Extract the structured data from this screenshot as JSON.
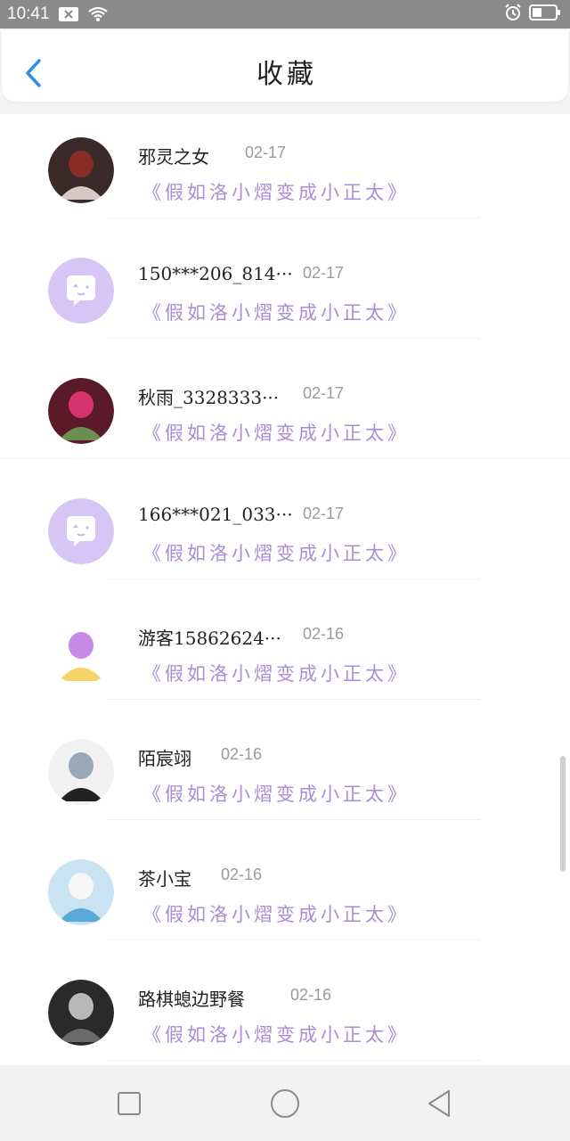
{
  "status_bar": {
    "time": "10:41"
  },
  "header": {
    "title": "收藏",
    "back_icon": "chevron-left-icon",
    "accent_color": "#2f8ee8"
  },
  "list": [
    {
      "name": "邪灵之女",
      "date": "02-17",
      "message": "《假如洛小熠变成小正太》",
      "avatar": "photo"
    },
    {
      "name": "150***206_814···",
      "date": "02-17",
      "message": "《假如洛小熠变成小正太》",
      "avatar": "default-chat"
    },
    {
      "name": "秋雨_3328333···",
      "date": "02-17",
      "message": "《假如洛小熠变成小正太》",
      "avatar": "photo"
    },
    {
      "name": "166***021_033···",
      "date": "02-17",
      "message": "《假如洛小熠变成小正太》",
      "avatar": "default-chat"
    },
    {
      "name": "游客15862624···",
      "date": "02-16",
      "message": "《假如洛小熠变成小正太》",
      "avatar": "photo"
    },
    {
      "name": "陌宸翊",
      "date": "02-16",
      "message": "《假如洛小熠变成小正太》",
      "avatar": "photo"
    },
    {
      "name": "茶小宝",
      "date": "02-16",
      "message": "《假如洛小熠变成小正太》",
      "avatar": "photo"
    },
    {
      "name": "路棋螅边野餐",
      "date": "02-16",
      "message": "《假如洛小熠变成小正太》",
      "avatar": "photo"
    }
  ],
  "colors": {
    "message": "#a98ed6",
    "default_avatar_bg": "#d6c6f5"
  },
  "nav": {
    "recent_icon": "square-icon",
    "home_icon": "circle-icon",
    "back_icon": "triangle-back-icon"
  }
}
